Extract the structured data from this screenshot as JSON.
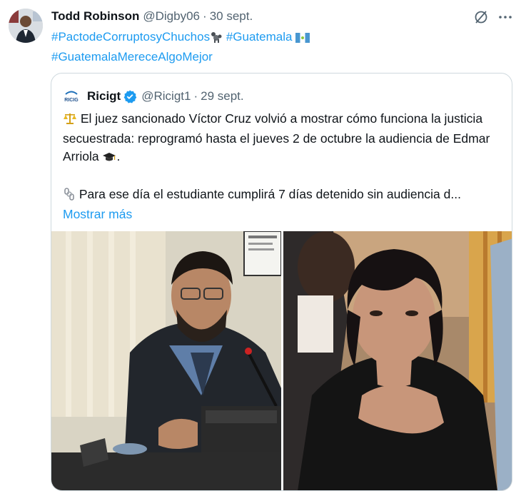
{
  "tweet": {
    "author_name": "Todd Robinson",
    "author_handle": "@Digby06",
    "separator": "·",
    "date": "30 sept.",
    "hashtags": [
      {
        "text": "#PactodeCorruptosyChuchos",
        "emoji": "poodle"
      },
      {
        "text": "#Guatemala",
        "emoji": "flag-guatemala"
      },
      {
        "text": "#GuatemalaMereceAlgoMejor"
      }
    ]
  },
  "quote": {
    "author_name": "Ricigt",
    "author_handle": "@Ricigt1",
    "separator": "·",
    "date": "29 sept.",
    "logo_text": "RICIG",
    "line1": "El juez sancionado Víctor Cruz volvió a mostrar cómo funciona la justicia secuestrada: reprogramó hasta el jueves 2 de octubre la audiencia de Edmar Arriola",
    "line1_end": ".",
    "line2": "Para ese día el estudiante cumplirá 7 días detenido sin audiencia d...",
    "show_more": "Mostrar más",
    "emojis": [
      "balance-scale",
      "graduation-cap",
      "chains"
    ]
  },
  "colors": {
    "link": "#1d9bf0",
    "text": "#0f1419",
    "secondary": "#536471",
    "border": "#cfd9de",
    "verified": "#1d9bf0"
  },
  "icons": [
    "grok-icon",
    "more-icon",
    "verified-icon"
  ]
}
